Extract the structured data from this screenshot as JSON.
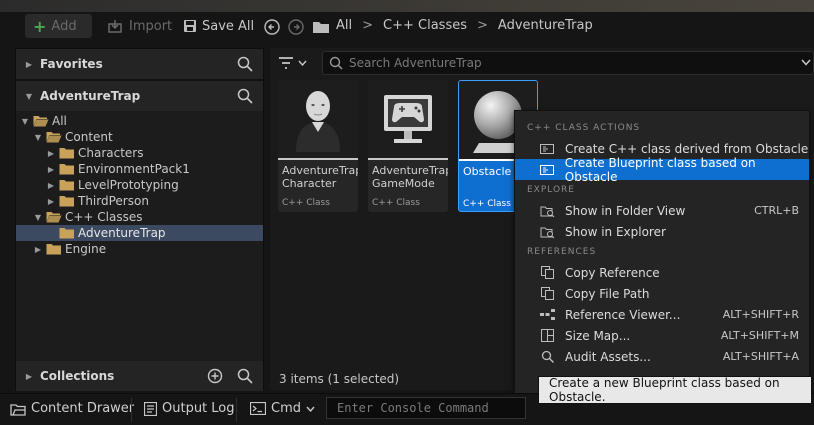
{
  "toolbar": {
    "add_label": "Add",
    "import_label": "Import",
    "save_all_label": "Save All",
    "breadcrumbs": [
      "All",
      "C++ Classes",
      "AdventureTrap"
    ]
  },
  "left_panel": {
    "favorites_label": "Favorites",
    "root_label": "AdventureTrap",
    "collections_label": "Collections",
    "tree": [
      {
        "label": "All",
        "depth": 0,
        "expanded": true
      },
      {
        "label": "Content",
        "depth": 1,
        "expanded": true
      },
      {
        "label": "Characters",
        "depth": 2,
        "expanded": false
      },
      {
        "label": "EnvironmentPack1",
        "depth": 2,
        "expanded": false
      },
      {
        "label": "LevelPrototyping",
        "depth": 2,
        "expanded": false
      },
      {
        "label": "ThirdPerson",
        "depth": 2,
        "expanded": false
      },
      {
        "label": "C++ Classes",
        "depth": 1,
        "expanded": true
      },
      {
        "label": "AdventureTrap",
        "depth": 2,
        "selected": true
      },
      {
        "label": "Engine",
        "depth": 1,
        "expanded": false
      }
    ]
  },
  "content": {
    "search_placeholder": "Search AdventureTrap",
    "tiles": [
      {
        "line1": "AdventureTrap",
        "line2": "Character",
        "type": "C++ Class",
        "icon": "person-icon"
      },
      {
        "line1": "AdventureTrap",
        "line2": "GameMode",
        "type": "C++ Class",
        "icon": "gamepad-monitor-icon"
      },
      {
        "line1": "Obstacle",
        "line2": "",
        "type": "C++ Class",
        "icon": "sphere-icon",
        "selected": true
      }
    ],
    "status": "3 items (1 selected)"
  },
  "context_menu": {
    "sections": [
      {
        "header": "C++ CLASS ACTIONS",
        "items": [
          {
            "label": "Create C++ class derived from Obstacle",
            "shortcut": "",
            "icon": "cpp-class-icon"
          },
          {
            "label": "Create Blueprint class based on Obstacle",
            "shortcut": "",
            "icon": "blueprint-class-icon",
            "highlighted": true
          }
        ]
      },
      {
        "header": "EXPLORE",
        "items": [
          {
            "label": "Show in Folder View",
            "shortcut": "CTRL+B",
            "icon": "folder-search-icon"
          },
          {
            "label": "Show in Explorer",
            "shortcut": "",
            "icon": "folder-search-icon"
          }
        ]
      },
      {
        "header": "REFERENCES",
        "items": [
          {
            "label": "Copy Reference",
            "shortcut": "",
            "icon": "copy-icon"
          },
          {
            "label": "Copy File Path",
            "shortcut": "",
            "icon": "copy-icon"
          },
          {
            "label": "Reference Viewer...",
            "shortcut": "ALT+SHIFT+R",
            "icon": "reference-graph-icon"
          },
          {
            "label": "Size Map...",
            "shortcut": "ALT+SHIFT+M",
            "icon": "size-map-icon"
          },
          {
            "label": "Audit Assets...",
            "shortcut": "ALT+SHIFT+A",
            "icon": "audit-icon"
          }
        ]
      }
    ]
  },
  "tooltip": "Create a new Blueprint class based on Obstacle.",
  "bottom_bar": {
    "content_drawer": "Content Drawer",
    "output_log": "Output Log",
    "cmd": "Cmd",
    "console_placeholder": "Enter Console Command"
  },
  "colors": {
    "accent": "#0f6fd1",
    "panel": "#1c1c1c",
    "background": "#151515",
    "folder": "#c9a25a"
  }
}
